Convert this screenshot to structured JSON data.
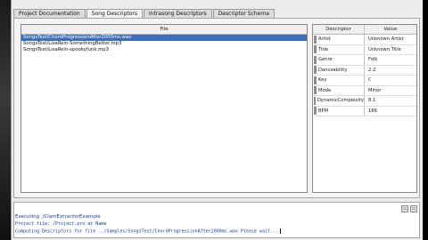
{
  "tabs": [
    {
      "label": "Project Documentation",
      "active": false
    },
    {
      "label": "Song Descriptors",
      "active": true
    },
    {
      "label": "Intrasong Descriptors",
      "active": false
    },
    {
      "label": "Descriptor Schema",
      "active": false
    }
  ],
  "file_list": {
    "header": "File",
    "rows": [
      {
        "name": "SongsTest/ChordProgressionAfter2000ms.wav",
        "selected": true
      },
      {
        "name": "SongsTest/LisaRein-SomethingBetter.mp3",
        "selected": false
      },
      {
        "name": "SongsTest/LisaRein-spookyfunk.mp3",
        "selected": false
      }
    ]
  },
  "descriptors": {
    "headers": [
      "Descriptor",
      "Value"
    ],
    "rows": [
      {
        "descriptor": "Artist",
        "value": "Unknown Artist"
      },
      {
        "descriptor": "Title",
        "value": "Unknown Title"
      },
      {
        "descriptor": "Genre",
        "value": "Folk"
      },
      {
        "descriptor": "Danceability",
        "value": "2.2"
      },
      {
        "descriptor": "Key",
        "value": "C"
      },
      {
        "descriptor": "Mode",
        "value": "Minor"
      },
      {
        "descriptor": "DynamicComplexity",
        "value": "8.1"
      },
      {
        "descriptor": "BPM",
        "value": "186"
      }
    ]
  },
  "console": {
    "title": "Executing ./ClamExtractorExample",
    "lines": [
      "Project file:   /Project.pro at Name",
      "Computing Descriptors for file  ../Samples/SongsTest/ChordProgressionAfter2000ms.wav Please wait..."
    ],
    "controls": [
      "▫",
      "▭"
    ]
  },
  "colors": {
    "selection": "#3d6fb6",
    "console_text": "#1a3c8a"
  }
}
